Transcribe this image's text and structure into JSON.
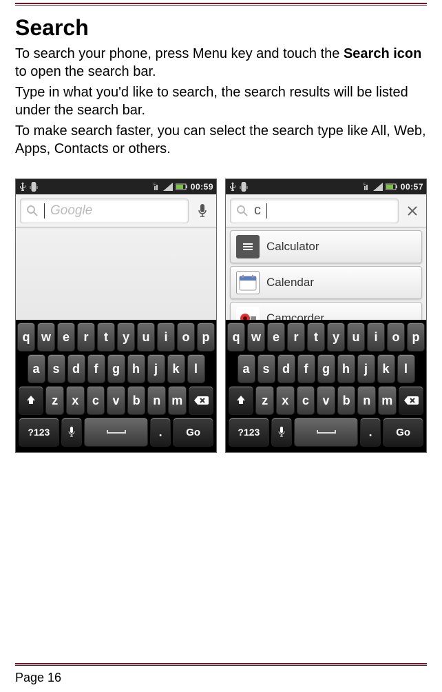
{
  "heading": "Search",
  "para1_a": "To search your phone, press Menu key and touch the ",
  "para1_b": "Search icon",
  "para1_c": " to open the search bar.",
  "para2": "Type in what you'd like to search, the search results will be listed under the search bar.",
  "para3": "To make search faster, you can select the search type like All, Web, Apps, Contacts or others.",
  "footer": "Page 16",
  "left": {
    "time": "00:59",
    "placeholder": "Google"
  },
  "right": {
    "time": "00:57",
    "query": "c",
    "results": [
      "Calculator",
      "Calendar",
      "Camcorder"
    ]
  },
  "keys": {
    "row1": [
      "q",
      "w",
      "e",
      "r",
      "t",
      "y",
      "u",
      "i",
      "o",
      "p"
    ],
    "row2": [
      "a",
      "s",
      "d",
      "f",
      "g",
      "h",
      "j",
      "k",
      "l"
    ],
    "row3": [
      "z",
      "x",
      "c",
      "v",
      "b",
      "n",
      "m"
    ],
    "sym": "?123",
    "go": "Go",
    "dot": "."
  }
}
